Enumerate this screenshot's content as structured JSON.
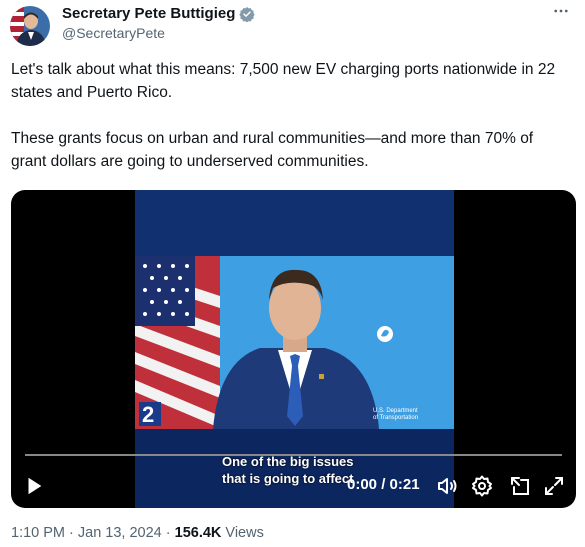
{
  "author": {
    "name": "Secretary Pete Buttigieg",
    "handle": "@SecretaryPete",
    "verified_badge_color": "#829aab"
  },
  "more_icon": "more-horizontal-icon",
  "tweet": {
    "paragraph_1": "Let's talk about what this means: 7,500 new EV charging ports nationwide in 22 states and Puerto Rico.",
    "paragraph_2": "These grants focus on urban and rural communities—and more than 70% of grant dollars are going to underserved communities."
  },
  "video": {
    "subtitle_line_1": "One of the big issues",
    "subtitle_line_2": "that is going to affect",
    "time_display": "0:00 / 0:21",
    "progress": 0.0,
    "logo_text_1": "U.S. Department",
    "logo_text_2": "of Transportation",
    "channel_number": "2",
    "controls": [
      "play-icon",
      "volume-icon",
      "settings-icon",
      "pip-icon",
      "fullscreen-icon"
    ]
  },
  "meta": {
    "time": "1:10 PM · Jan 13, 2024 · ",
    "views_count": "156.4K",
    "views_label": " Views"
  },
  "colors": {
    "accent": "#1d9bf0",
    "secondary_text": "#536471"
  }
}
